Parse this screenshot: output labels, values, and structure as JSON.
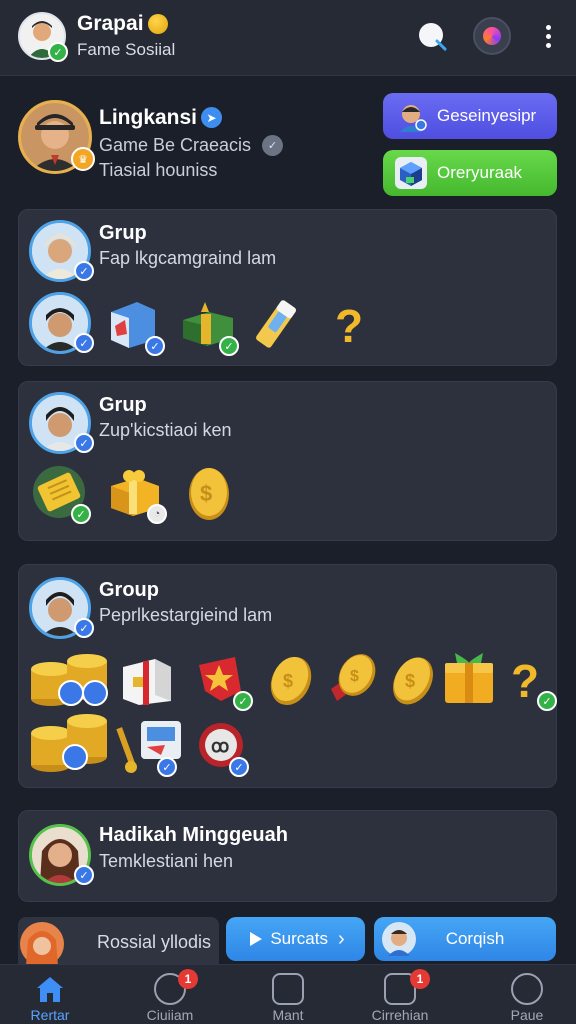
{
  "header": {
    "title": "Grapai",
    "subtitle": "Fame Sosiial"
  },
  "profile": {
    "name": "Lingkansi",
    "line1": "Game Be Craeacis",
    "line2": "Tiasial houniss",
    "primary_button": "Geseinyesipr",
    "secondary_button": "Oreryuraak"
  },
  "cards": [
    {
      "title": "Grup",
      "subtitle": "Fap lkgcamgraind lam",
      "items": [
        "box-icon",
        "gift-icon",
        "ticket-icon",
        "question-icon"
      ]
    },
    {
      "title": "Grup",
      "subtitle": "Zup'kicstiaoi ken",
      "items": [
        "ticket-icon",
        "gift-icon",
        "coin-icon"
      ]
    },
    {
      "title": "Group",
      "subtitle": "Peprlkestargieind lam",
      "items": [
        "coin-stack-icon",
        "gift-box-icon",
        "badge-icon",
        "coin-icon",
        "medal-icon",
        "coin-icon",
        "gift-icon",
        "question-icon",
        "coin-stack-icon",
        "key-icon",
        "token-icon"
      ]
    },
    {
      "title": "Hadikah Minggeuah",
      "subtitle": "Temklestiani hen"
    }
  ],
  "bottom_strip": {
    "text": "Rossial yllodis",
    "button1": "Surcats",
    "button1_arrow": "›",
    "button2": "Corqish"
  },
  "nav": [
    {
      "label": "Rertar",
      "active": true
    },
    {
      "label": "Ciuiiam",
      "badge": "1"
    },
    {
      "label": "Mant"
    },
    {
      "label": "Cirrehian",
      "badge": "1"
    },
    {
      "label": "Paue"
    }
  ],
  "colors": {
    "background": "#1b1f29",
    "card": "#2c313d",
    "accent_blue": "#3e8ef0",
    "accent_green": "#45b82f",
    "accent_purple": "#5a5be8",
    "badge_red": "#e53935"
  }
}
